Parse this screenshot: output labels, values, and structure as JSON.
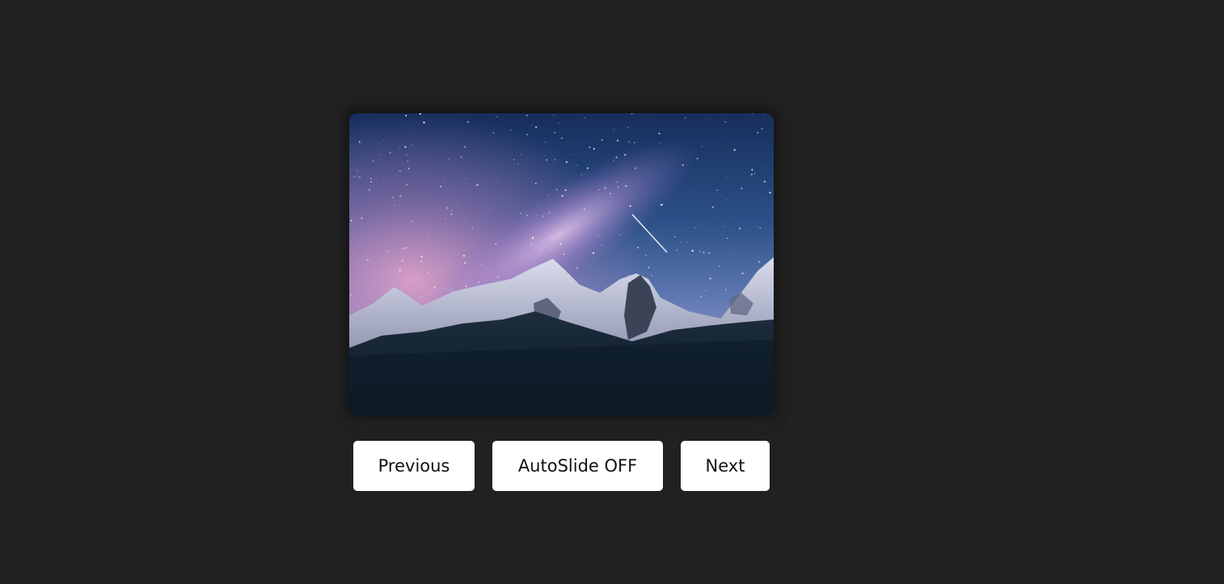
{
  "slideshow": {
    "current_image": "night-mountain-milky-way-image",
    "colors": {
      "background": "#212121",
      "button_bg": "#ffffff",
      "button_text": "#111111"
    }
  },
  "controls": {
    "previous_label": "Previous",
    "autoslide_label": "AutoSlide OFF",
    "next_label": "Next"
  }
}
